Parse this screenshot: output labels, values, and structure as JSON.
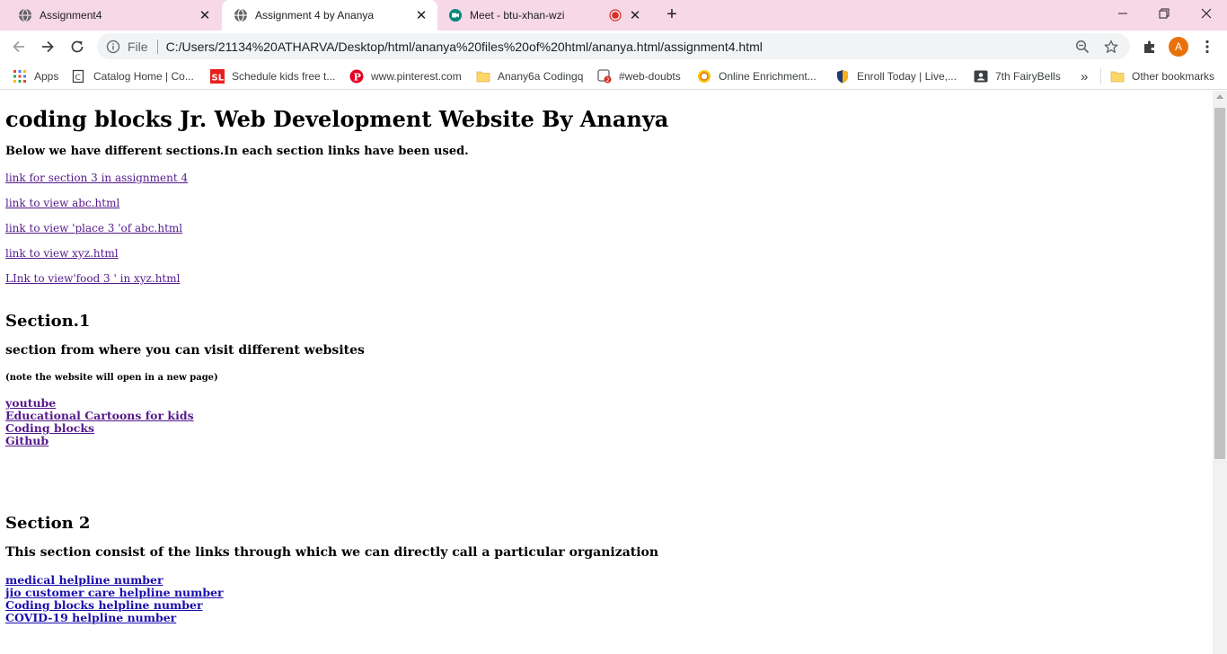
{
  "tabs": [
    {
      "title": "Assignment4",
      "icon": "globe-icon",
      "active": false
    },
    {
      "title": "Assignment 4 by Ananya",
      "icon": "globe-icon",
      "active": true
    },
    {
      "title": "Meet - btu-xhan-wzi",
      "icon": "meet-icon",
      "active": false,
      "recording": true
    }
  ],
  "toolbar": {
    "scheme": "File",
    "url": "C:/Users/21134%20ATHARVA/Desktop/html/ananya%20files%20of%20html/ananya.html/assignment4.html",
    "avatar_letter": "A"
  },
  "bookmarks": [
    {
      "label": "Apps",
      "icon": "apps-grid-icon"
    },
    {
      "label": "Catalog Home | Co...",
      "icon": "catalog-icon"
    },
    {
      "label": "Schedule kids free t...",
      "icon": "sl-logo-icon"
    },
    {
      "label": "www.pinterest.com",
      "icon": "pinterest-icon"
    },
    {
      "label": "Anany6a Codingq",
      "icon": "folder-icon"
    },
    {
      "label": "#web-doubts",
      "icon": "web-doubts-icon"
    },
    {
      "label": "Online Enrichment...",
      "icon": "enrichment-icon"
    },
    {
      "label": "Enroll Today | Live,...",
      "icon": "shield-icon"
    },
    {
      "label": "7th FairyBells",
      "icon": "contact-card-icon"
    },
    {
      "label": "Other bookmarks",
      "icon": "folder-icon"
    }
  ],
  "overflow_label": "»",
  "page": {
    "heading": "coding blocks Jr. Web Development Website By Ananya",
    "intro": "Below we have different sections.In each section links have been used.",
    "top_links": [
      "link for section 3 in assignment 4",
      "link to view abc.html",
      "link to view 'place 3 'of abc.html",
      "link to view xyz.html",
      "LInk to view'food 3 ' in xyz.html"
    ],
    "section1": {
      "title": "Section.1",
      "subtitle": "section from where you can visit different websites",
      "note": "(note the website will open in a new page)",
      "links": [
        "youtube",
        "Educational Cartoons for kids",
        "Coding blocks",
        "Github"
      ]
    },
    "section2": {
      "title": "Section 2",
      "subtitle": "This section consist of the links through which we can directly call a particular organization",
      "links": [
        "medical helpline number",
        "jio customer care helpline number",
        "Coding blocks helpline number",
        "COVID-19 helpline number"
      ]
    }
  },
  "colors": {
    "tabstrip": "#f7d8e6",
    "visited_link": "#551a8b",
    "unvisited_link": "#1a0dab",
    "avatar": "#e8710a",
    "record": "#d93025"
  }
}
